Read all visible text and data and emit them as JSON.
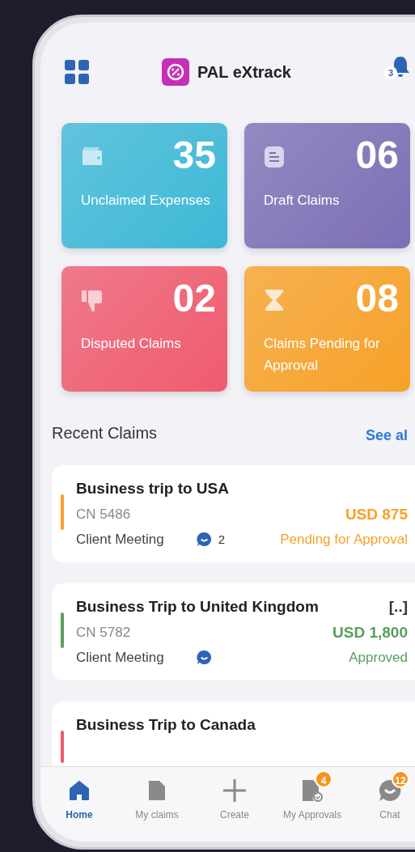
{
  "header": {
    "title": "PAL eXtrack",
    "notification_count": "3"
  },
  "stats": [
    {
      "kind": "wallet",
      "value": "35",
      "label": "Unclaimed Expenses",
      "color": "#3db8d6"
    },
    {
      "kind": "document",
      "value": "06",
      "label": "Draft Claims",
      "color": "#7d6fb5"
    },
    {
      "kind": "thumbs-down",
      "value": "02",
      "label": "Disputed Claims",
      "color": "#ef5b6e"
    },
    {
      "kind": "hourglass",
      "value": "08",
      "label": "Claims Pending for Approval",
      "color": "#f7a128"
    }
  ],
  "recent_claims": {
    "title": "Recent Claims",
    "link": "See al"
  },
  "claims": [
    {
      "title": "Business trip to USA",
      "number": "CN 5486",
      "purpose": "Client Meeting",
      "amount": "USD 875",
      "status": "Pending for Approval",
      "color": "#f7a128",
      "comments": true,
      "comment_count": "2"
    },
    {
      "title": "Business Trip to United Kingdom",
      "more": "[..]",
      "number": "CN 5782",
      "purpose": "Client Meeting",
      "amount": "USD 1,800",
      "status": "Approved",
      "color": "#5a9e5e",
      "comments": true
    },
    {
      "title": "Business Trip to Canada",
      "color": "#ef5b6e"
    }
  ],
  "nav": [
    {
      "kind": "home",
      "label": "Home",
      "selected": true
    },
    {
      "kind": "claims",
      "label": "My claims",
      "selected": false
    },
    {
      "kind": "create",
      "label": "Create",
      "selected": false
    },
    {
      "kind": "approvals",
      "label": "My Approvals",
      "selected": false,
      "badge": "4"
    },
    {
      "kind": "chat",
      "label": "Chat",
      "selected": false,
      "badge": "12"
    }
  ]
}
